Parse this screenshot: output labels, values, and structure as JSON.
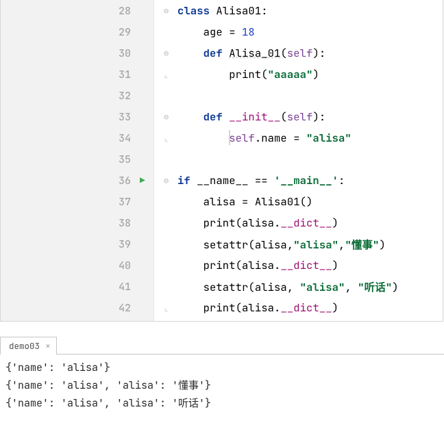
{
  "editor": {
    "lines": [
      {
        "n": 28,
        "fold": "open",
        "tokens": [
          [
            "kw",
            "class"
          ],
          [
            "",
            ""
          ],
          [
            "cls",
            " Alisa01"
          ],
          [
            "",
            ":"
          ]
        ]
      },
      {
        "n": 29,
        "fold": null,
        "indent": 4,
        "tokens": [
          [
            "ident",
            "age"
          ],
          [
            "",
            " = "
          ],
          [
            "num",
            "18"
          ]
        ]
      },
      {
        "n": 30,
        "fold": "open",
        "indent": 4,
        "tokens": [
          [
            "kw",
            "def"
          ],
          [
            "",
            " "
          ],
          [
            "fn wavy",
            "Alisa_01"
          ],
          [
            "",
            "("
          ],
          [
            "self",
            "self"
          ],
          [
            "",
            "):"
          ]
        ]
      },
      {
        "n": 31,
        "fold": "close",
        "indent": 8,
        "tokens": [
          [
            "bi",
            "print"
          ],
          [
            "",
            "("
          ],
          [
            "str",
            "\"aaaaa\""
          ],
          [
            "",
            ")"
          ]
        ],
        "wavy_under": true
      },
      {
        "n": 32,
        "fold": null,
        "indent": 0,
        "tokens": []
      },
      {
        "n": 33,
        "fold": "open",
        "indent": 4,
        "tokens": [
          [
            "kw",
            "def"
          ],
          [
            "",
            " "
          ],
          [
            "mag",
            "__init__"
          ],
          [
            "",
            "("
          ],
          [
            "self",
            "self"
          ],
          [
            "",
            "):"
          ]
        ]
      },
      {
        "n": 34,
        "fold": "close",
        "indent": 8,
        "caret_col": 0,
        "tokens": [
          [
            "self",
            "self"
          ],
          [
            "",
            ".name = "
          ],
          [
            "str",
            "\"alisa\""
          ]
        ]
      },
      {
        "n": 35,
        "fold": null,
        "indent": 0,
        "tokens": []
      },
      {
        "n": 36,
        "fold": "open",
        "run": true,
        "tokens": [
          [
            "kw",
            "if"
          ],
          [
            "",
            " __name__ == "
          ],
          [
            "str",
            "'__main__'"
          ],
          [
            "",
            ":"
          ]
        ]
      },
      {
        "n": 37,
        "fold": null,
        "indent": 4,
        "tokens": [
          [
            "ident",
            "alisa"
          ],
          [
            "",
            " = Alisa01()"
          ]
        ]
      },
      {
        "n": 38,
        "fold": null,
        "indent": 4,
        "tokens": [
          [
            "bi",
            "print"
          ],
          [
            "",
            "(alisa."
          ],
          [
            "mag",
            "__dict__"
          ],
          [
            "",
            ")"
          ]
        ]
      },
      {
        "n": 39,
        "fold": null,
        "indent": 4,
        "tokens": [
          [
            "bi",
            "setattr"
          ],
          [
            "",
            "(alisa,"
          ],
          [
            "str",
            "\"alisa\""
          ],
          [
            "",
            ","
          ],
          [
            "str",
            "\"懂事\""
          ],
          [
            "",
            ")"
          ]
        ]
      },
      {
        "n": 40,
        "fold": null,
        "indent": 4,
        "tokens": [
          [
            "bi",
            "print"
          ],
          [
            "",
            "(alisa."
          ],
          [
            "mag",
            "__dict__"
          ],
          [
            "",
            ")"
          ]
        ]
      },
      {
        "n": 41,
        "fold": null,
        "indent": 4,
        "tokens": [
          [
            "bi",
            "setattr"
          ],
          [
            "",
            "(alisa, "
          ],
          [
            "str",
            "\"alisa\""
          ],
          [
            "",
            ", "
          ],
          [
            "str",
            "\"听话\""
          ],
          [
            "",
            ")"
          ]
        ]
      },
      {
        "n": 42,
        "fold": "close",
        "indent": 4,
        "tokens": [
          [
            "bi",
            "print"
          ],
          [
            "",
            "(alisa."
          ],
          [
            "mag",
            "__dict__"
          ],
          [
            "",
            ")"
          ]
        ]
      }
    ]
  },
  "output": {
    "tab_label": "demo03",
    "lines": [
      "{'name': 'alisa'}",
      "{'name': 'alisa', 'alisa': '懂事'}",
      "{'name': 'alisa', 'alisa': '听话'}"
    ]
  }
}
